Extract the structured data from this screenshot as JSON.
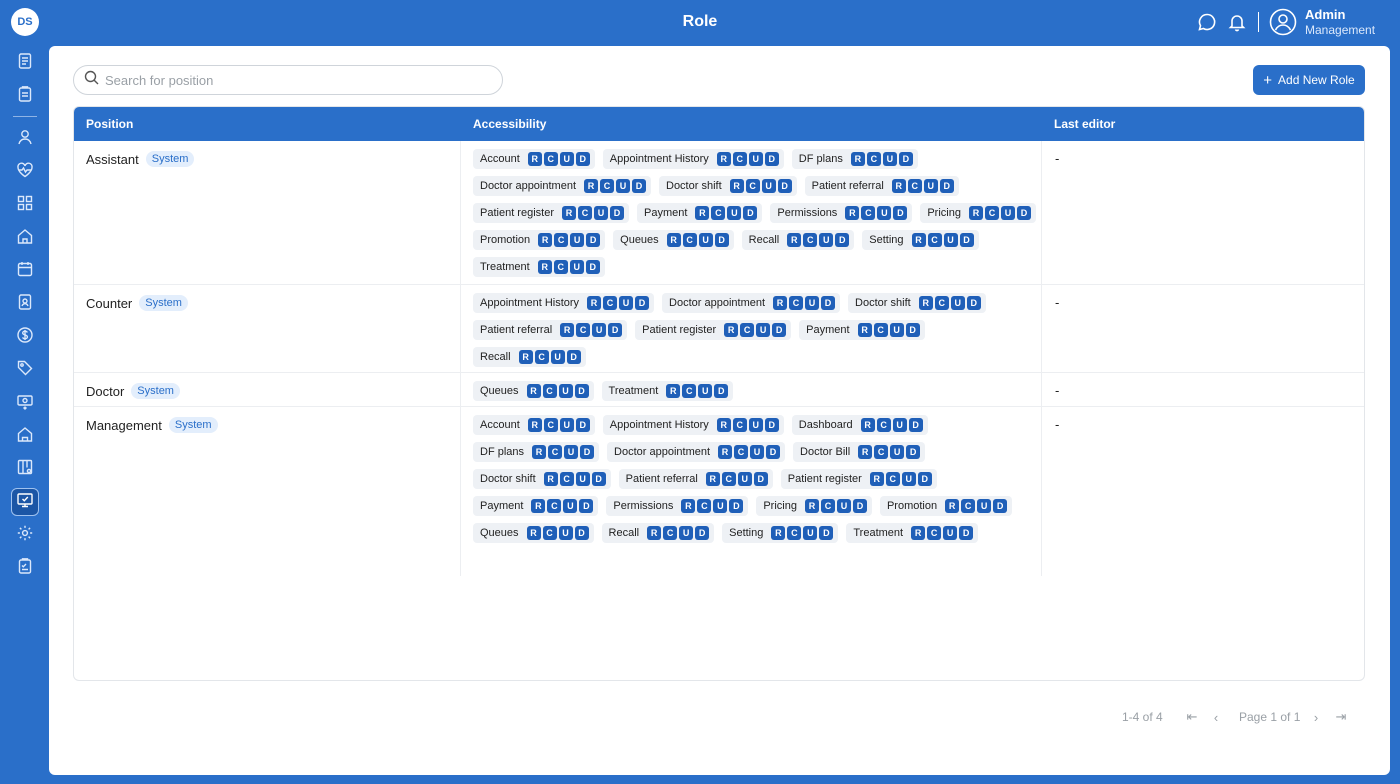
{
  "header": {
    "logo_text": "DS",
    "title": "Role",
    "user_name": "Admin",
    "user_role": "Management"
  },
  "sidebar": {
    "items": [
      {
        "icon": "document-icon"
      },
      {
        "icon": "clipboard-icon"
      },
      {
        "icon": "user-icon"
      },
      {
        "icon": "heart-pulse-icon"
      },
      {
        "icon": "grid-icon"
      },
      {
        "icon": "home-icon"
      },
      {
        "icon": "calendar-icon"
      },
      {
        "icon": "id-card-icon"
      },
      {
        "icon": "dollar-icon"
      },
      {
        "icon": "tag-icon"
      },
      {
        "icon": "cash-icon"
      },
      {
        "icon": "building-icon"
      },
      {
        "icon": "layout-icon"
      },
      {
        "icon": "monitor-check-icon",
        "active": true
      },
      {
        "icon": "gear-icon"
      },
      {
        "icon": "checklist-icon"
      }
    ]
  },
  "search": {
    "placeholder": "Search for position",
    "value": ""
  },
  "add_button": {
    "label": "Add New Role"
  },
  "table": {
    "headers": {
      "position": "Position",
      "accessibility": "Accessibility",
      "last_editor": "Last editor"
    },
    "perm_letters": [
      "R",
      "C",
      "U",
      "D"
    ],
    "rows": [
      {
        "position": "Assistant",
        "badge": "System",
        "last_editor": "-",
        "permissions": [
          "Account",
          "Appointment History",
          "DF plans",
          "Doctor appointment",
          "Doctor shift",
          "Patient referral",
          "Patient register",
          "Payment",
          "Permissions",
          "Pricing",
          "Promotion",
          "Queues",
          "Recall",
          "Setting",
          "Treatment"
        ]
      },
      {
        "position": "Counter",
        "badge": "System",
        "last_editor": "-",
        "permissions": [
          "Appointment History",
          "Doctor appointment",
          "Doctor shift",
          "Patient referral",
          "Patient register",
          "Payment",
          "Recall"
        ]
      },
      {
        "position": "Doctor",
        "badge": "System",
        "last_editor": "-",
        "permissions": [
          "Queues",
          "Treatment"
        ]
      },
      {
        "position": "Management",
        "badge": "System",
        "last_editor": "-",
        "permissions": [
          "Account",
          "Appointment History",
          "Dashboard",
          "DF plans",
          "Doctor appointment",
          "Doctor Bill",
          "Doctor shift",
          "Patient referral",
          "Patient register",
          "Payment",
          "Permissions",
          "Pricing",
          "Promotion",
          "Queues",
          "Recall",
          "Setting",
          "Treatment"
        ]
      }
    ]
  },
  "pagination": {
    "range": "1-4 of 4",
    "page": "Page 1 of 1"
  },
  "colors": {
    "primary": "#2a6fc9",
    "perm_badge": "#1f5fb8",
    "chip_bg": "#eef1f5"
  }
}
